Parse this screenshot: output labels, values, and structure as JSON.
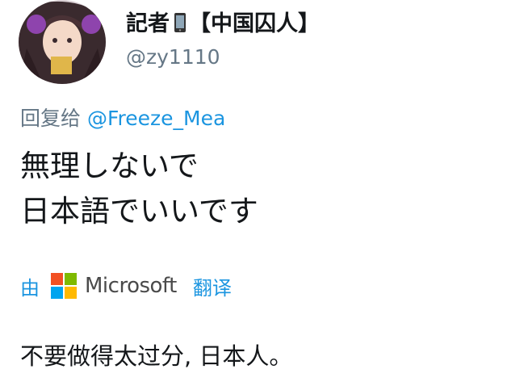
{
  "author": {
    "display_name_prefix": "記者",
    "display_name_suffix": "【中国囚人】",
    "handle": "@zy1110"
  },
  "reply": {
    "prefix": "回复给",
    "mention": "@Freeze_Mea"
  },
  "tweet": {
    "text": "無理しないで\n日本語でいいです"
  },
  "translation_bar": {
    "by_label": "由",
    "brand": "Microsoft",
    "link_label": "翻译"
  },
  "translation": {
    "text": "不要做得太过分, 日本人。"
  },
  "colors": {
    "link": "#1b95e0",
    "secondary": "#657786",
    "text": "#14171a"
  },
  "icons": {
    "phone": "phone-icon",
    "brand_logo": "microsoft-logo-icon"
  }
}
